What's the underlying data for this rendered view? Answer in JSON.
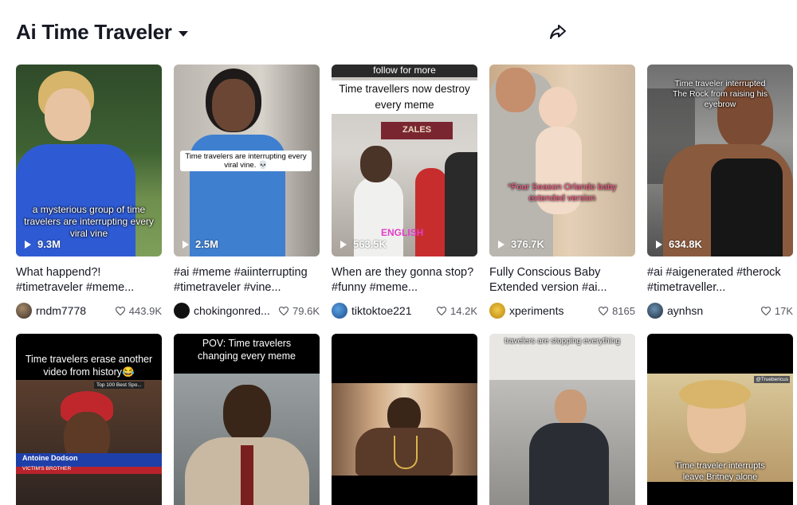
{
  "header": {
    "title": "Ai Time Traveler"
  },
  "videos": [
    {
      "views": "9.3M",
      "overlay": "a mysterious group of time travelers are interrupting every viral vine",
      "description": "What happend?! #timetraveler #meme...",
      "user": "rndm7778",
      "likes": "443.9K"
    },
    {
      "views": "2.5M",
      "overlay": "Time travelers are interrupting every viral vine. 💀",
      "description": "#ai #meme #aiinterrupting #timetraveler #vine...",
      "user": "chokingonred...",
      "likes": "79.6K"
    },
    {
      "views": "563.5K",
      "banner": "follow for more",
      "overlay": "Time travellers now destroy every meme",
      "store_sign": "ZALES",
      "tag": "ENGLISH",
      "description": "When are they gonna stop? #funny #meme...",
      "user": "tiktoktoe221",
      "likes": "14.2K"
    },
    {
      "views": "376.7K",
      "overlay": "*Four Season Orlando baby extended version",
      "description": "Fully Conscious Baby Extended version #ai...",
      "user": "xperiments",
      "likes": "8165"
    },
    {
      "views": "634.8K",
      "overlay": "Time traveler interrupted The Rock from raising his eyebrow",
      "description": "#ai #aigenerated #therock #timetraveller...",
      "user": "aynhsn",
      "likes": "17K"
    }
  ],
  "row2": [
    {
      "banner": "Time travelers erase another video from history😂",
      "chyron_name": "Antoine Dodson",
      "chyron_sub": "VICTIM'S BROTHER",
      "news_label": "Top 100 Best Spo..."
    },
    {
      "banner": "POV: Time travelers changing every meme"
    },
    {},
    {
      "banner": "travelers are stopping everything"
    },
    {
      "watermark": "@Truebericus",
      "overlay": "Time traveler interrupts leave Britney alone"
    }
  ],
  "colors": {
    "text": "#161823",
    "muted": "#55575f",
    "overlay_pink": "#ff5c8a",
    "tag_pink": "#e040c8"
  }
}
